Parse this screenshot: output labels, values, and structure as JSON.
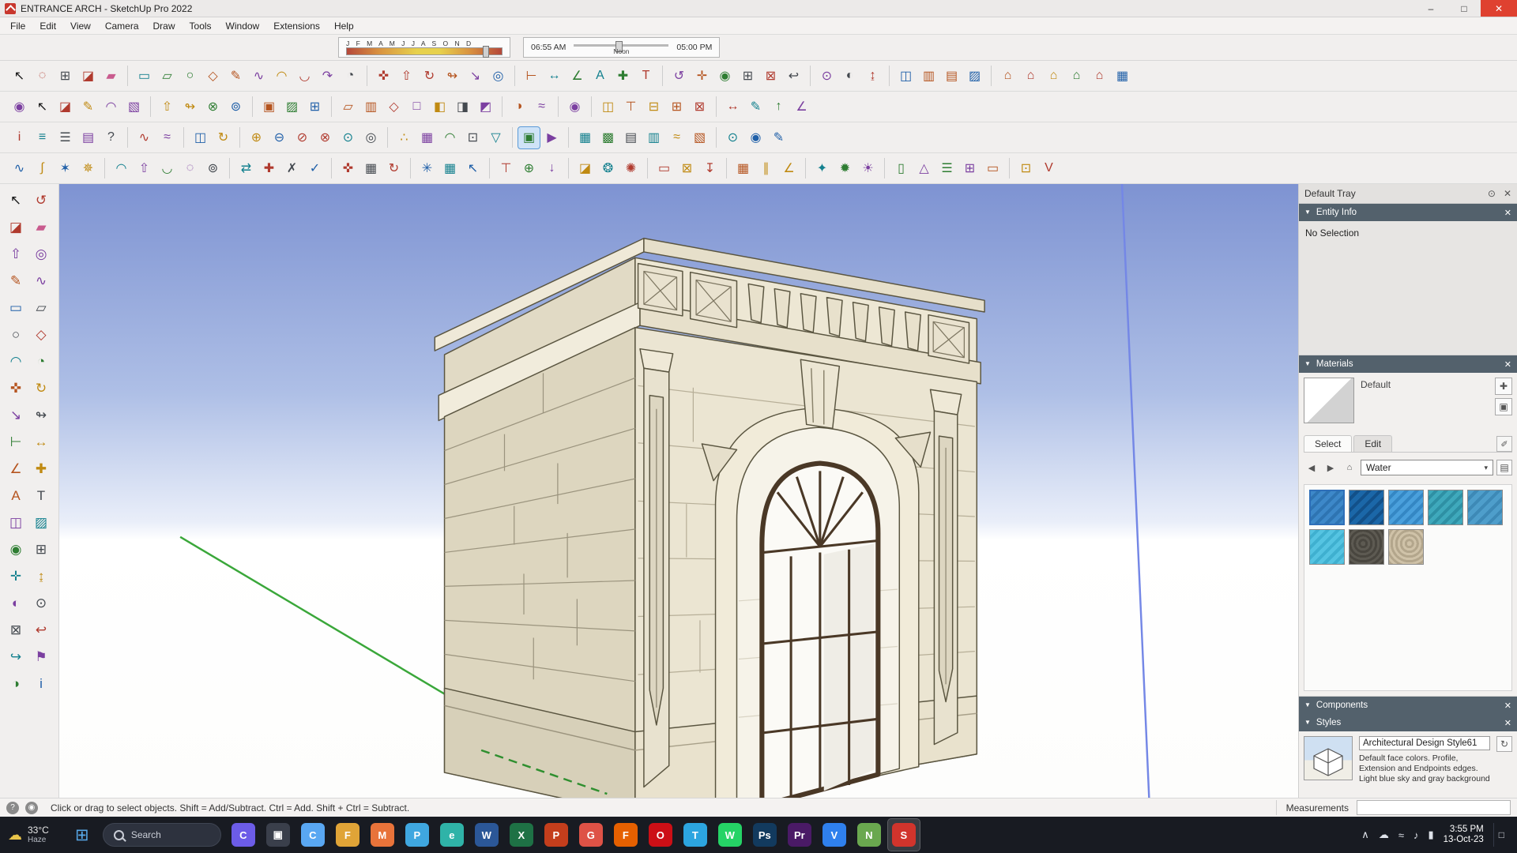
{
  "window": {
    "title": "ENTRANCE ARCH - SketchUp Pro 2022"
  },
  "glyphs": {
    "minimize": "–",
    "maximize": "□",
    "close": "✕",
    "collapse": "▼",
    "caret": "▾",
    "back": "◀",
    "forward": "▶",
    "home": "⌂",
    "plus": "✚",
    "panel": "▣",
    "dropper": "✐",
    "details": "▤",
    "refresh": "↻",
    "start": "⊞",
    "weather": "☁",
    "help": "?",
    "geo": "◉",
    "pin": "⊙"
  },
  "menu": [
    "File",
    "Edit",
    "View",
    "Camera",
    "Draw",
    "Tools",
    "Window",
    "Extensions",
    "Help"
  ],
  "shadow_bar": {
    "months": "J F M A M J J A S O N D",
    "time_start": "06:55 AM",
    "time_mid": "Noon",
    "time_end": "05:00 PM"
  },
  "toolbar_rows": [
    [
      [
        [
          "select",
          "↖"
        ],
        [
          "lasso",
          "◌"
        ],
        [
          "make-component",
          "⊞"
        ],
        [
          "paint-bucket",
          "◪"
        ],
        [
          "eraser",
          "▰"
        ]
      ],
      [
        [
          "rectangle",
          "▭"
        ],
        [
          "rotated-rectangle",
          "▱"
        ],
        [
          "circle",
          "○"
        ],
        [
          "polygon",
          "◇"
        ],
        [
          "line",
          "✎"
        ],
        [
          "freehand",
          "∿"
        ],
        [
          "arc",
          "◠"
        ],
        [
          "two-point-arc",
          "◡"
        ],
        [
          "three-point-arc",
          "↷"
        ],
        [
          "pie",
          "◔"
        ]
      ],
      [
        [
          "move",
          "✜"
        ],
        [
          "push-pull",
          "⇧"
        ],
        [
          "rotate",
          "↻"
        ],
        [
          "follow-me",
          "↬"
        ],
        [
          "scale",
          "↘"
        ],
        [
          "offset",
          "◎"
        ]
      ],
      [
        [
          "tape-measure",
          "⊢"
        ],
        [
          "dimensions",
          "↔"
        ],
        [
          "protractor",
          "∠"
        ],
        [
          "text",
          "A"
        ],
        [
          "axes",
          "✚"
        ],
        [
          "3d-text",
          "T"
        ]
      ],
      [
        [
          "orbit",
          "↺"
        ],
        [
          "pan",
          "✛"
        ],
        [
          "zoom",
          "◉"
        ],
        [
          "zoom-window",
          "⊞"
        ],
        [
          "zoom-extents",
          "⊠"
        ],
        [
          "zoom-previous",
          "↩"
        ]
      ],
      [
        [
          "position-camera",
          "⊙"
        ],
        [
          "look-around",
          "◐"
        ],
        [
          "walk",
          "↨"
        ]
      ],
      [
        [
          "section-plane",
          "◫"
        ],
        [
          "section-display",
          "▥"
        ],
        [
          "section-cuts",
          "▤"
        ],
        [
          "section-fill",
          "▨"
        ]
      ],
      [
        [
          "3d-warehouse",
          "⌂"
        ],
        [
          "extension-warehouse",
          "⌂"
        ],
        [
          "share-model",
          "⌂"
        ],
        [
          "share-component",
          "⌂"
        ],
        [
          "model-home",
          "⌂"
        ],
        [
          "components-panel",
          "▦"
        ]
      ]
    ],
    [
      [
        [
          "zoom-selection",
          "◉"
        ],
        [
          "select-arrow",
          "↖"
        ],
        [
          "paint-large",
          "◪"
        ],
        [
          "pencil-line",
          "✎"
        ],
        [
          "pencil-arc",
          "◠"
        ],
        [
          "gradient-swatch",
          "▧"
        ]
      ],
      [
        [
          "push-pull-copy",
          "⇧"
        ],
        [
          "follow-path",
          "↬"
        ],
        [
          "intersect-faces",
          "⊗"
        ],
        [
          "outer-shell",
          "⊚"
        ]
      ],
      [
        [
          "match-photo",
          "▣"
        ],
        [
          "edit-texture",
          "▨"
        ],
        [
          "position-texture",
          "⊞"
        ]
      ],
      [
        [
          "x-ray",
          "▱"
        ],
        [
          "back-edges",
          "▥"
        ],
        [
          "wireframe",
          "◇"
        ],
        [
          "hidden-line",
          "□"
        ],
        [
          "shaded",
          "◧"
        ],
        [
          "shaded-with-textures",
          "◨"
        ],
        [
          "monochrome",
          "◩"
        ]
      ],
      [
        [
          "shadows",
          "◑"
        ],
        [
          "fog",
          "≈"
        ]
      ],
      [
        [
          "search-warehouse",
          "◉"
        ]
      ],
      [
        [
          "iso-view",
          "◫"
        ],
        [
          "top-view",
          "⊤"
        ],
        [
          "front-view",
          "⊟"
        ],
        [
          "right-view",
          "⊞"
        ],
        [
          "left-view",
          "⊠"
        ]
      ],
      [
        [
          "smart-dimension",
          "↔"
        ],
        [
          "leader-text",
          "✎"
        ],
        [
          "north-arrow",
          "↑"
        ],
        [
          "angle-guide",
          "∠"
        ]
      ]
    ],
    [
      [
        [
          "entity-info-toggle",
          "i"
        ],
        [
          "layers",
          "≡"
        ],
        [
          "outliner",
          "☰"
        ],
        [
          "scenes",
          "▤"
        ],
        [
          "instructor",
          "?"
        ]
      ],
      [
        [
          "soften-edges",
          "∿"
        ],
        [
          "smooth-surface",
          "≈"
        ]
      ],
      [
        [
          "section-plane-2",
          "◫"
        ],
        [
          "rotate-section",
          "↻"
        ]
      ],
      [
        [
          "solid-union",
          "⊕"
        ],
        [
          "solid-subtract",
          "⊖"
        ],
        [
          "solid-trim",
          "⊘"
        ],
        [
          "solid-intersect",
          "⊗"
        ],
        [
          "solid-split",
          "⊙"
        ],
        [
          "outer-shell-2",
          "◎"
        ]
      ],
      [
        [
          "from-contours",
          "∴"
        ],
        [
          "from-scratch",
          "▦"
        ],
        [
          "smoove",
          "◠"
        ],
        [
          "stamp",
          "⊡"
        ],
        [
          "drape",
          "▽"
        ]
      ],
      [
        [
          "section-display-toggle",
          "▣"
        ],
        [
          "play-animation",
          "▶"
        ]
      ],
      [
        [
          "texture-brick",
          "▦"
        ],
        [
          "texture-stone",
          "▩"
        ],
        [
          "texture-wood",
          "▤"
        ],
        [
          "texture-tile",
          "▥"
        ],
        [
          "texture-water",
          "≈"
        ],
        [
          "texture-metal",
          "▧"
        ]
      ],
      [
        [
          "advanced-camera",
          "⊙"
        ],
        [
          "preview-camera",
          "◉"
        ],
        [
          "edit-camera",
          "✎"
        ]
      ]
    ],
    [
      [
        [
          "bezier-curve",
          "∿"
        ],
        [
          "polyline-3d",
          "∫"
        ],
        [
          "spiral",
          "✶"
        ],
        [
          "helix",
          "✵"
        ]
      ],
      [
        [
          "round-corner",
          "◠"
        ],
        [
          "joint-push-pull",
          "⇧"
        ],
        [
          "curviloft",
          "◡"
        ],
        [
          "soap-skin",
          "◌"
        ],
        [
          "shell",
          "⊚"
        ]
      ],
      [
        [
          "mirror",
          "⇄"
        ],
        [
          "weld",
          "✚"
        ],
        [
          "purge",
          "✗"
        ],
        [
          "cleanup",
          "✓"
        ]
      ],
      [
        [
          "move-copy",
          "✜"
        ],
        [
          "array-copy",
          "▦"
        ],
        [
          "rotate-copy",
          "↻"
        ]
      ],
      [
        [
          "vertex-tools",
          "✳"
        ],
        [
          "quad-face-tools",
          "▦"
        ],
        [
          "selection-toys",
          "↖"
        ]
      ],
      [
        [
          "align",
          "⊤"
        ],
        [
          "center-point",
          "⊕"
        ],
        [
          "drop-at-intersection",
          "↓"
        ]
      ],
      [
        [
          "paint-plus",
          "◪"
        ],
        [
          "color-wheel",
          "❂"
        ],
        [
          "material-replacer",
          "✺"
        ]
      ],
      [
        [
          "export-2d",
          "▭"
        ],
        [
          "export-3d",
          "⊠"
        ],
        [
          "import-file",
          "↧"
        ]
      ],
      [
        [
          "grid-tool",
          "▦"
        ],
        [
          "guide-lines",
          "∥"
        ],
        [
          "angle-protractor",
          "∠"
        ]
      ],
      [
        [
          "render-scene",
          "✦"
        ],
        [
          "light-source",
          "✹"
        ],
        [
          "sun-position",
          "☀"
        ]
      ],
      [
        [
          "wall-tool",
          "▯"
        ],
        [
          "roof-tool",
          "△"
        ],
        [
          "stairs-tool",
          "☰"
        ],
        [
          "window-tool",
          "⊞"
        ],
        [
          "door-tool",
          "▭"
        ]
      ],
      [
        [
          "area-measure",
          "⊡"
        ],
        [
          "volume-measure",
          "V"
        ]
      ]
    ]
  ],
  "left_toolbar": [
    [
      "select",
      "↖"
    ],
    [
      "orbit",
      "↺"
    ],
    [
      "paint-bucket",
      "◪"
    ],
    [
      "eraser",
      "▰"
    ],
    [
      "push-pull",
      "⇧"
    ],
    [
      "offset",
      "◎"
    ],
    [
      "line",
      "✎"
    ],
    [
      "freehand",
      "∿"
    ],
    [
      "rectangle",
      "▭"
    ],
    [
      "rotated-rectangle",
      "▱"
    ],
    [
      "circle",
      "○"
    ],
    [
      "polygon",
      "◇"
    ],
    [
      "arc",
      "◠"
    ],
    [
      "pie",
      "◔"
    ],
    [
      "move",
      "✜"
    ],
    [
      "rotate",
      "↻"
    ],
    [
      "scale",
      "↘"
    ],
    [
      "follow-me",
      "↬"
    ],
    [
      "tape-measure",
      "⊢"
    ],
    [
      "dimensions",
      "↔"
    ],
    [
      "protractor",
      "∠"
    ],
    [
      "axes",
      "✚"
    ],
    [
      "text",
      "A"
    ],
    [
      "3d-text",
      "T"
    ],
    [
      "section-plane",
      "◫"
    ],
    [
      "section-fill",
      "▨"
    ],
    [
      "zoom",
      "◉"
    ],
    [
      "zoom-window",
      "⊞"
    ],
    [
      "pan",
      "✛"
    ],
    [
      "walk",
      "↨"
    ],
    [
      "look-around",
      "◐"
    ],
    [
      "position-camera",
      "⊙"
    ],
    [
      "zoom-extents",
      "⊠"
    ],
    [
      "previous-view",
      "↩"
    ],
    [
      "next-view",
      "↪"
    ],
    [
      "add-location",
      "⚑"
    ],
    [
      "shadows-toggle",
      "◑"
    ],
    [
      "model-info",
      "i"
    ]
  ],
  "tray": {
    "title": "Default Tray",
    "entity_info": {
      "title": "Entity Info",
      "status": "No Selection"
    },
    "materials": {
      "title": "Materials",
      "current": "Default",
      "tabs": [
        "Select",
        "Edit"
      ],
      "collection": "Water",
      "swatches": [
        [
          "water-blue",
          "repeating-linear-gradient(135deg,#3d88c9 0 5px,#2e74b2 5px 9px)"
        ],
        [
          "water-deep-blue",
          "repeating-linear-gradient(135deg,#1b67a8 0 6px,#125089 6px 10px)"
        ],
        [
          "water-sky",
          "repeating-linear-gradient(135deg,#4aa0dc 0 5px,#3487c4 5px 9px)"
        ],
        [
          "water-teal",
          "repeating-linear-gradient(135deg,#3fa9bc 0 5px,#2e90a4 5px 9px)"
        ],
        [
          "water-steel",
          "repeating-linear-gradient(135deg,#4e9ecb 0 6px,#3d89b6 6px 10px)"
        ],
        [
          "water-light",
          "repeating-linear-gradient(135deg,#55c4e2 0 5px,#3fb0d0 5px 9px)"
        ],
        [
          "gravel-dark",
          "repeating-radial-gradient(circle at 40% 40%,#5d5a52 0 3px,#49463f 3px 6px)"
        ],
        [
          "gravel-tan",
          "repeating-radial-gradient(circle at 60% 40%,#cfc2a8 0 3px,#b3a68c 3px 6px)"
        ]
      ]
    },
    "components": {
      "title": "Components"
    },
    "styles": {
      "title": "Styles",
      "name": "Architectural Design Style61",
      "description": "Default face colors. Profile, Extension and Endpoints edges. Light blue sky and gray background colors."
    }
  },
  "status_bar": {
    "hint": "Click or drag to select objects. Shift = Add/Subtract. Ctrl = Add. Shift + Ctrl = Subtract.",
    "measurements_label": "Measurements",
    "measurements_value": ""
  },
  "taskbar": {
    "weather": {
      "temp": "33°C",
      "condition": "Haze"
    },
    "search_placeholder": "Search",
    "apps": [
      [
        "copilot",
        "C",
        "#6c5ce7"
      ],
      [
        "task-view",
        "▣",
        "#3a3f4b"
      ],
      [
        "chat",
        "C",
        "#59a7f2"
      ],
      [
        "file-explorer",
        "F",
        "#e0a437"
      ],
      [
        "media-player",
        "M",
        "#e8733a"
      ],
      [
        "photos",
        "P",
        "#3fa7e0"
      ],
      [
        "edge",
        "e",
        "#2fb3a8"
      ],
      [
        "word",
        "W",
        "#2b5797"
      ],
      [
        "excel",
        "X",
        "#1e7145"
      ],
      [
        "powerpoint",
        "P",
        "#c43e1c"
      ],
      [
        "chrome",
        "G",
        "#de5246"
      ],
      [
        "firefox",
        "F",
        "#e66000"
      ],
      [
        "opera",
        "O",
        "#cc0f16"
      ],
      [
        "telegram",
        "T",
        "#2ca5e0"
      ],
      [
        "whatsapp",
        "W",
        "#25d366"
      ],
      [
        "photoshop",
        "Ps",
        "#123a5e"
      ],
      [
        "premiere",
        "Pr",
        "#4a1a66"
      ],
      [
        "vscode",
        "V",
        "#2f80ed"
      ],
      [
        "notepad",
        "N",
        "#6aa84f"
      ],
      [
        "sketchup",
        "S",
        "#d1342c",
        "active"
      ]
    ],
    "tray_icons": [
      [
        "hidden-icons",
        "∧"
      ],
      [
        "onedrive",
        "☁"
      ],
      [
        "network",
        "≈"
      ],
      [
        "volume",
        "♪"
      ],
      [
        "battery",
        "▮"
      ]
    ],
    "clock": {
      "time": "3:55 PM",
      "date": "13-Oct-23"
    },
    "notification": "□"
  }
}
